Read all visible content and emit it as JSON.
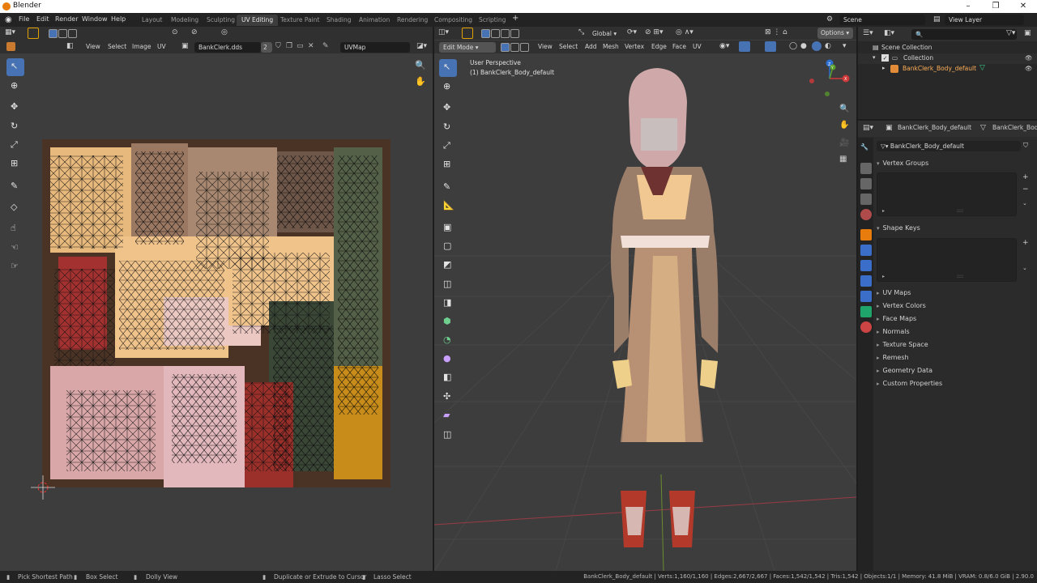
{
  "window": {
    "title": "Blender",
    "controls": [
      "–",
      "❐",
      "✕"
    ]
  },
  "menu": [
    "File",
    "Edit",
    "Render",
    "Window",
    "Help"
  ],
  "workspaces": [
    {
      "label": "Layout",
      "active": false
    },
    {
      "label": "Modeling",
      "active": false
    },
    {
      "label": "Sculpting",
      "active": false
    },
    {
      "label": "UV Editing",
      "active": true
    },
    {
      "label": "Texture Paint",
      "active": false
    },
    {
      "label": "Shading",
      "active": false
    },
    {
      "label": "Animation",
      "active": false
    },
    {
      "label": "Rendering",
      "active": false
    },
    {
      "label": "Compositing",
      "active": false
    },
    {
      "label": "Scripting",
      "active": false
    }
  ],
  "add_workspace": "+",
  "scene": {
    "label": "Scene",
    "view_layer": "View Layer"
  },
  "uv_editor": {
    "menus": [
      "View",
      "Select",
      "Image",
      "UV"
    ],
    "image_name": "BankClerk.dds",
    "users": "2",
    "uvmap": "UVMap"
  },
  "viewport": {
    "mode": "Edit Mode",
    "menus": [
      "View",
      "Select",
      "Add",
      "Mesh",
      "Vertex",
      "Edge",
      "Face",
      "UV"
    ],
    "transform": "Global",
    "options": "Options",
    "perspective_label": "User Perspective",
    "object_label": "(1) BankClerk_Body_default",
    "axes": {
      "x": "X",
      "y": "Y",
      "z": "Z"
    }
  },
  "outliner": {
    "search_placeholder": "",
    "scene_collection": "Scene Collection",
    "collection": "Collection",
    "object": "BankClerk_Body_default"
  },
  "properties": {
    "breadcrumb_object": "BankClerk_Body_default",
    "breadcrumb_mesh": "BankClerk_Body",
    "datablock": "BankClerk_Body_default",
    "panels": [
      "Vertex Groups",
      "Shape Keys"
    ],
    "collapsed_panels": [
      "UV Maps",
      "Vertex Colors",
      "Face Maps",
      "Normals",
      "Texture Space",
      "Remesh",
      "Geometry Data",
      "Custom Properties"
    ]
  },
  "statusbar": {
    "left": [
      "Pick Shortest Path",
      "Box Select",
      "Dolly View"
    ],
    "middle": [
      "Duplicate or Extrude to Cursor",
      "Lasso Select"
    ],
    "stats": "BankClerk_Body_default | Verts:1,160/1,160 | Edges:2,667/2,667 | Faces:1,542/1,542 | Tris:1,542 | Objects:1/1 | Memory: 41.8 MiB | VRAM: 0.8/6.0 GiB | 2.90.0"
  },
  "colors": {
    "accent": "#4772b3",
    "orange": "#e87d0d",
    "bg": "#3d3d3d"
  }
}
